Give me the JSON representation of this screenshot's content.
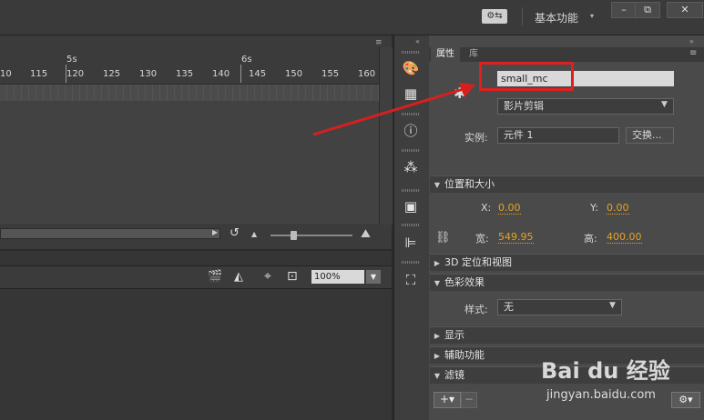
{
  "titlebar": {
    "workspace": "基本功能",
    "workspace_arrow": "▾",
    "minimize": "–",
    "restore": "⧉",
    "close": "✕",
    "sync_icon": "sync-settings-icon"
  },
  "timeline": {
    "seconds": [
      "5s",
      "6s"
    ],
    "frame_numbers": [
      "10",
      "115",
      "120",
      "125",
      "130",
      "135",
      "140",
      "145",
      "150",
      "155",
      "160"
    ]
  },
  "stage": {
    "zoom": "100%"
  },
  "properties": {
    "tabs": [
      "属性",
      "库"
    ],
    "instance_name": "small_mc",
    "type": "影片剪辑",
    "instance_label": "实例:",
    "instance_of": "元件 1",
    "swap_button": "交换...",
    "sections": {
      "position_size": "位置和大小",
      "three_d": "3D 定位和视图",
      "color_effect": "色彩效果",
      "display": "显示",
      "accessibility": "辅助功能",
      "filters": "滤镜"
    },
    "x_label": "X:",
    "x_value": "0.00",
    "y_label": "Y:",
    "y_value": "0.00",
    "w_label": "宽:",
    "w_value": "549.95",
    "h_label": "高:",
    "h_value": "400.00",
    "style_label": "样式:",
    "style_value": "无"
  },
  "watermark": {
    "brand": "Bai du 经验",
    "url": "jingyan.baidu.com"
  },
  "colors": {
    "highlight": "#e02020",
    "value_link": "#e3a423"
  }
}
